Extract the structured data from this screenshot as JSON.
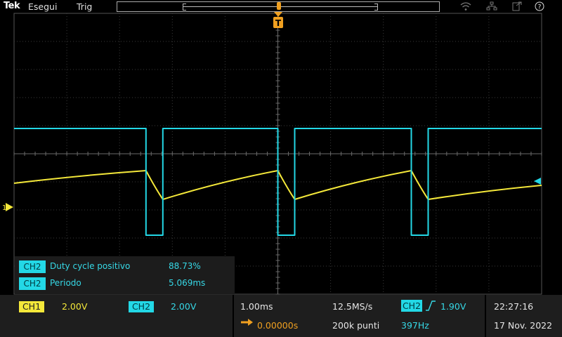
{
  "topbar": {
    "brand": "Tek",
    "menu": [
      "Esegui",
      "Trig"
    ],
    "icons": [
      "wifi-icon",
      "network-icon",
      "exit-icon",
      "help-icon"
    ],
    "help_glyph": "?"
  },
  "channels": {
    "ch1": {
      "label": "CH1",
      "scale": "2.00V",
      "color": "#f4e83a",
      "ground_marker": "1"
    },
    "ch2": {
      "label": "CH2",
      "scale": "2.00V",
      "color": "#23d8e6"
    }
  },
  "trigger_marker": "T",
  "measurements": [
    {
      "source": "CH2",
      "name": "Duty cycle positivo",
      "value": "88.73%"
    },
    {
      "source": "CH2",
      "name": "Periodo",
      "value": "5.069ms"
    }
  ],
  "horizontal": {
    "scale": "1.00ms",
    "sample_rate": "12.5MS/s",
    "delay": "0.00000s",
    "record_length": "200k punti"
  },
  "trigger": {
    "source": "CH2",
    "slope": "rising",
    "level": "1.90V",
    "frequency": "397Hz"
  },
  "clock": {
    "time": "22:27:16",
    "date": "17 Nov. 2022"
  },
  "chart_data": {
    "type": "line",
    "x_unit": "ms",
    "x_range": [
      -5,
      5
    ],
    "grid": "on",
    "series": [
      {
        "name": "CH1",
        "color": "#f4e83a",
        "x": [
          -5.0,
          -2.5,
          -2.5,
          -2.18,
          0.0,
          0.0,
          0.32,
          2.53,
          2.53,
          2.85,
          5.0
        ],
        "y": [
          1.7,
          2.6,
          2.6,
          0.55,
          2.6,
          2.6,
          0.55,
          2.6,
          2.6,
          0.55,
          1.55
        ]
      },
      {
        "name": "CH2",
        "color": "#23d8e6",
        "x": [
          -5.0,
          -2.5,
          -2.5,
          -2.18,
          -2.18,
          0.0,
          0.0,
          0.32,
          0.32,
          2.53,
          2.53,
          2.85,
          2.85,
          5.0
        ],
        "y": [
          5.6,
          5.6,
          -2.0,
          -2.0,
          5.6,
          5.6,
          -2.0,
          -2.0,
          5.6,
          5.6,
          -2.0,
          -2.0,
          5.6,
          5.6
        ]
      }
    ]
  }
}
